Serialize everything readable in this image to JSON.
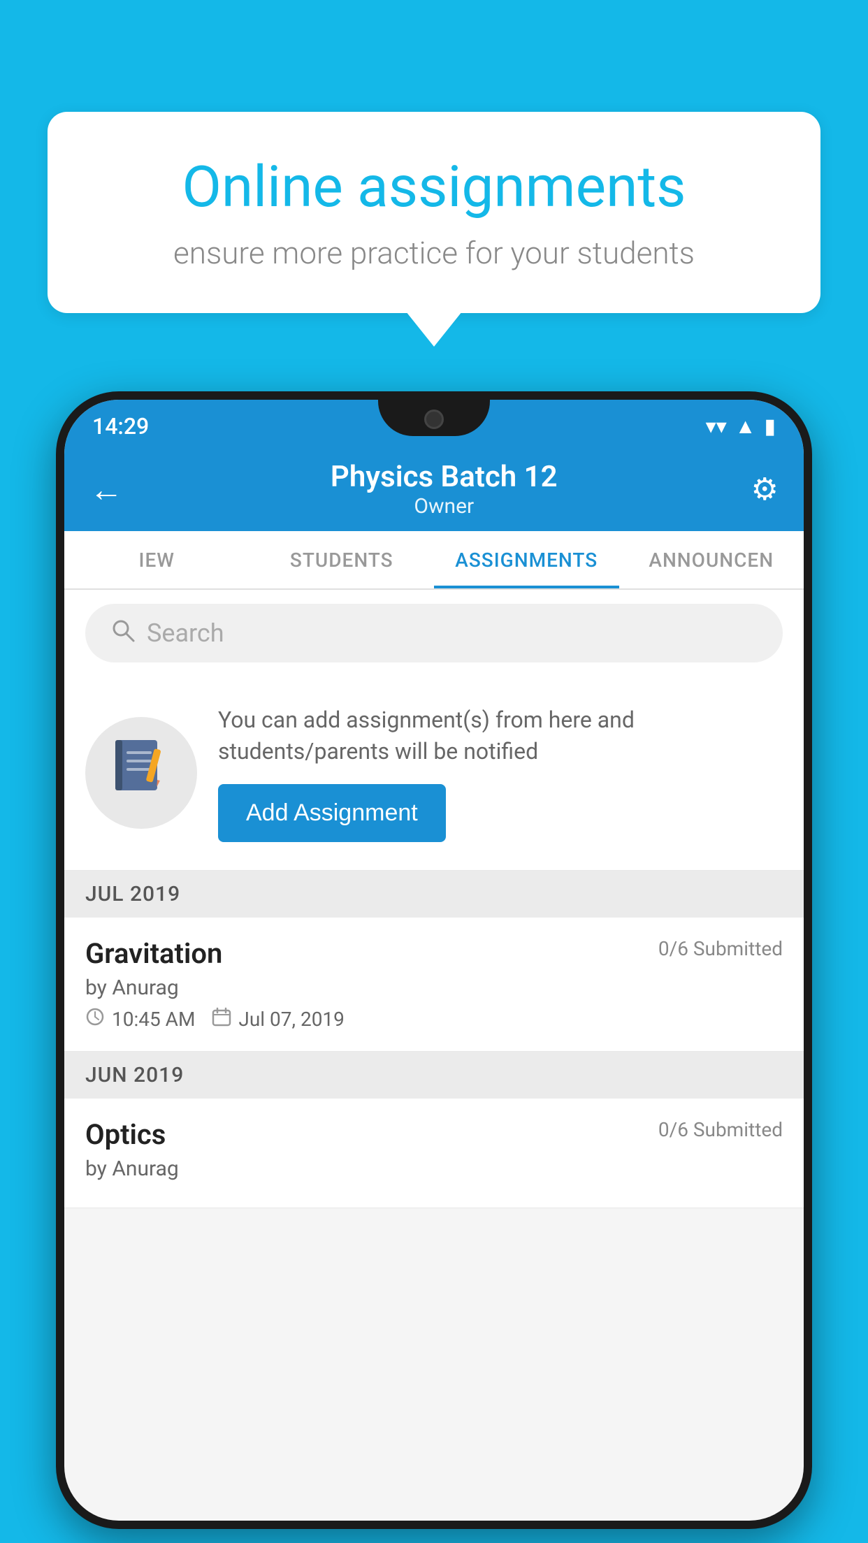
{
  "background": {
    "color": "#14b8e8"
  },
  "speech_bubble": {
    "title": "Online assignments",
    "subtitle": "ensure more practice for your students"
  },
  "phone": {
    "status_bar": {
      "time": "14:29",
      "icons": [
        "wifi",
        "signal",
        "battery"
      ]
    },
    "app_bar": {
      "title": "Physics Batch 12",
      "subtitle": "Owner",
      "back_label": "←",
      "settings_label": "⚙"
    },
    "tabs": [
      {
        "label": "IEW",
        "active": false
      },
      {
        "label": "STUDENTS",
        "active": false
      },
      {
        "label": "ASSIGNMENTS",
        "active": true
      },
      {
        "label": "ANNOUNCEN",
        "active": false
      }
    ],
    "search": {
      "placeholder": "Search"
    },
    "promo": {
      "description": "You can add assignment(s) from here and students/parents will be notified",
      "button_label": "Add Assignment"
    },
    "sections": [
      {
        "header": "JUL 2019",
        "assignments": [
          {
            "title": "Gravitation",
            "submitted": "0/6 Submitted",
            "author": "by Anurag",
            "time": "10:45 AM",
            "date": "Jul 07, 2019"
          }
        ]
      },
      {
        "header": "JUN 2019",
        "assignments": [
          {
            "title": "Optics",
            "submitted": "0/6 Submitted",
            "author": "by Anurag",
            "time": "",
            "date": ""
          }
        ]
      }
    ]
  }
}
